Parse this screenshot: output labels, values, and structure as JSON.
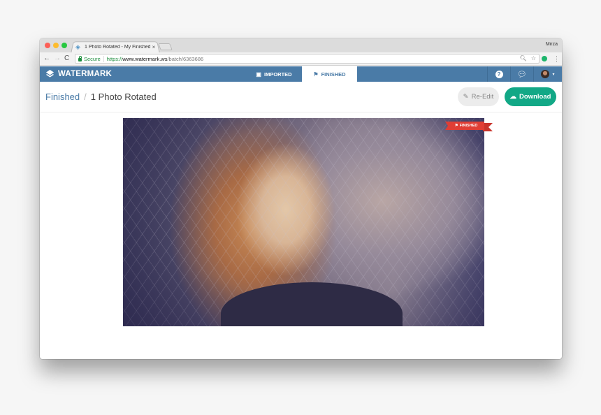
{
  "browser": {
    "tab_title": "1 Photo Rotated - My Finished",
    "tab_close": "×",
    "profile_name": "Mirza",
    "nav": {
      "back": "←",
      "forward": "→",
      "reload": "C"
    },
    "address": {
      "secure_label": "Secure",
      "url_scheme": "https://",
      "url_host": "www.watermark.ws",
      "url_path": "/batch/6363686"
    },
    "omnibox_icons": {
      "zoom": "🔍︎",
      "bookmark": "☆"
    },
    "menu": "⋮"
  },
  "app": {
    "brand": "WATERMARK",
    "nav_tabs": [
      {
        "label": "IMPORTED",
        "icon": "image-icon",
        "glyph": "▣",
        "active": false
      },
      {
        "label": "FINISHED",
        "icon": "flag-icon",
        "glyph": "⚑",
        "active": true
      }
    ],
    "header_actions": {
      "help": "?",
      "chat": "💬︎",
      "user_caret": "▾"
    },
    "colors": {
      "primary": "#4a7ba7",
      "download": "#12a886",
      "ribbon": "#e03e35"
    }
  },
  "page": {
    "breadcrumb": {
      "parent": "Finished",
      "separator": "/",
      "current": "1 Photo Rotated"
    },
    "buttons": {
      "reedit": {
        "label": "Re-Edit",
        "icon": "✎"
      },
      "download": {
        "label": "Download",
        "icon": "☁"
      }
    },
    "photo": {
      "badge_label": "FINISHED",
      "badge_icon": "⚑",
      "alt": "Portrait of a red-haired woman by a chain-link fence"
    }
  }
}
